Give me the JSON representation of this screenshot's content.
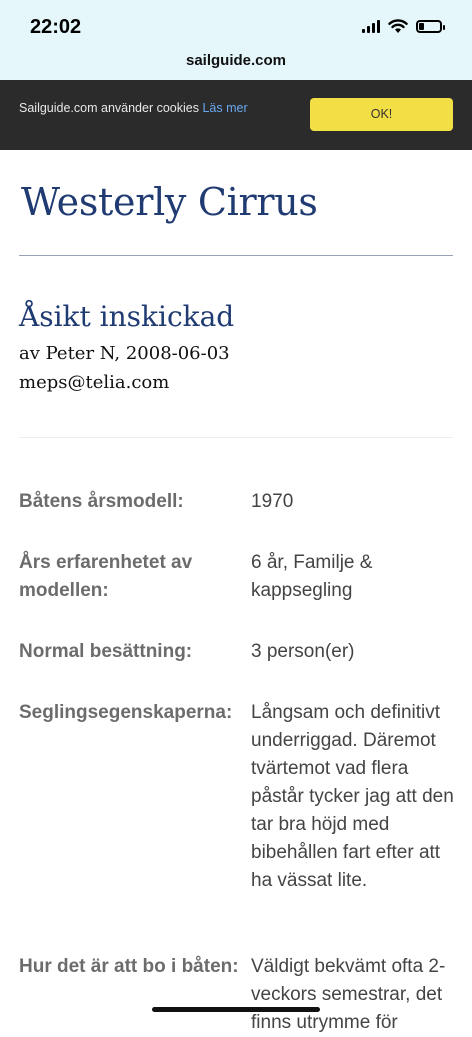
{
  "status_bar": {
    "time": "22:02",
    "icons": [
      "cellular-signal-icon",
      "wifi-icon",
      "battery-icon"
    ],
    "background": "#e6f7fb"
  },
  "browser": {
    "url": "sailguide.com"
  },
  "cookie_banner": {
    "text": "Sailguide.com använder cookies",
    "link": "Läs mer",
    "ok_button": "OK!",
    "colors": {
      "background": "#2b2b2b",
      "button": "#f2de45",
      "link": "#6aa8f2"
    }
  },
  "page": {
    "title": "Westerly Cirrus",
    "title_color": "#1f3b72"
  },
  "review": {
    "heading": "Åsikt inskickad",
    "author_line": "av Peter N, 2008-06-03",
    "email": "meps@telia.com",
    "fields": [
      {
        "label": "Båtens årsmodell:",
        "value": "1970"
      },
      {
        "label": "Års erfarenhetet av modellen:",
        "value": "6 år, Familje & kappsegling"
      },
      {
        "label": "Normal besättning:",
        "value": "3 person(er)"
      },
      {
        "label": "Seglingsegenskaperna:",
        "value": "Långsam och definitivt underriggad. Däremot tvärtemot vad flera påstår tycker jag att den tar bra höjd med bibehållen fart efter att ha vässat lite."
      },
      {
        "label": "Hur det är att bo i båten:",
        "value": "Väldigt bekvämt ofta 2-veckors semestrar, det finns utrymme för"
      }
    ]
  }
}
